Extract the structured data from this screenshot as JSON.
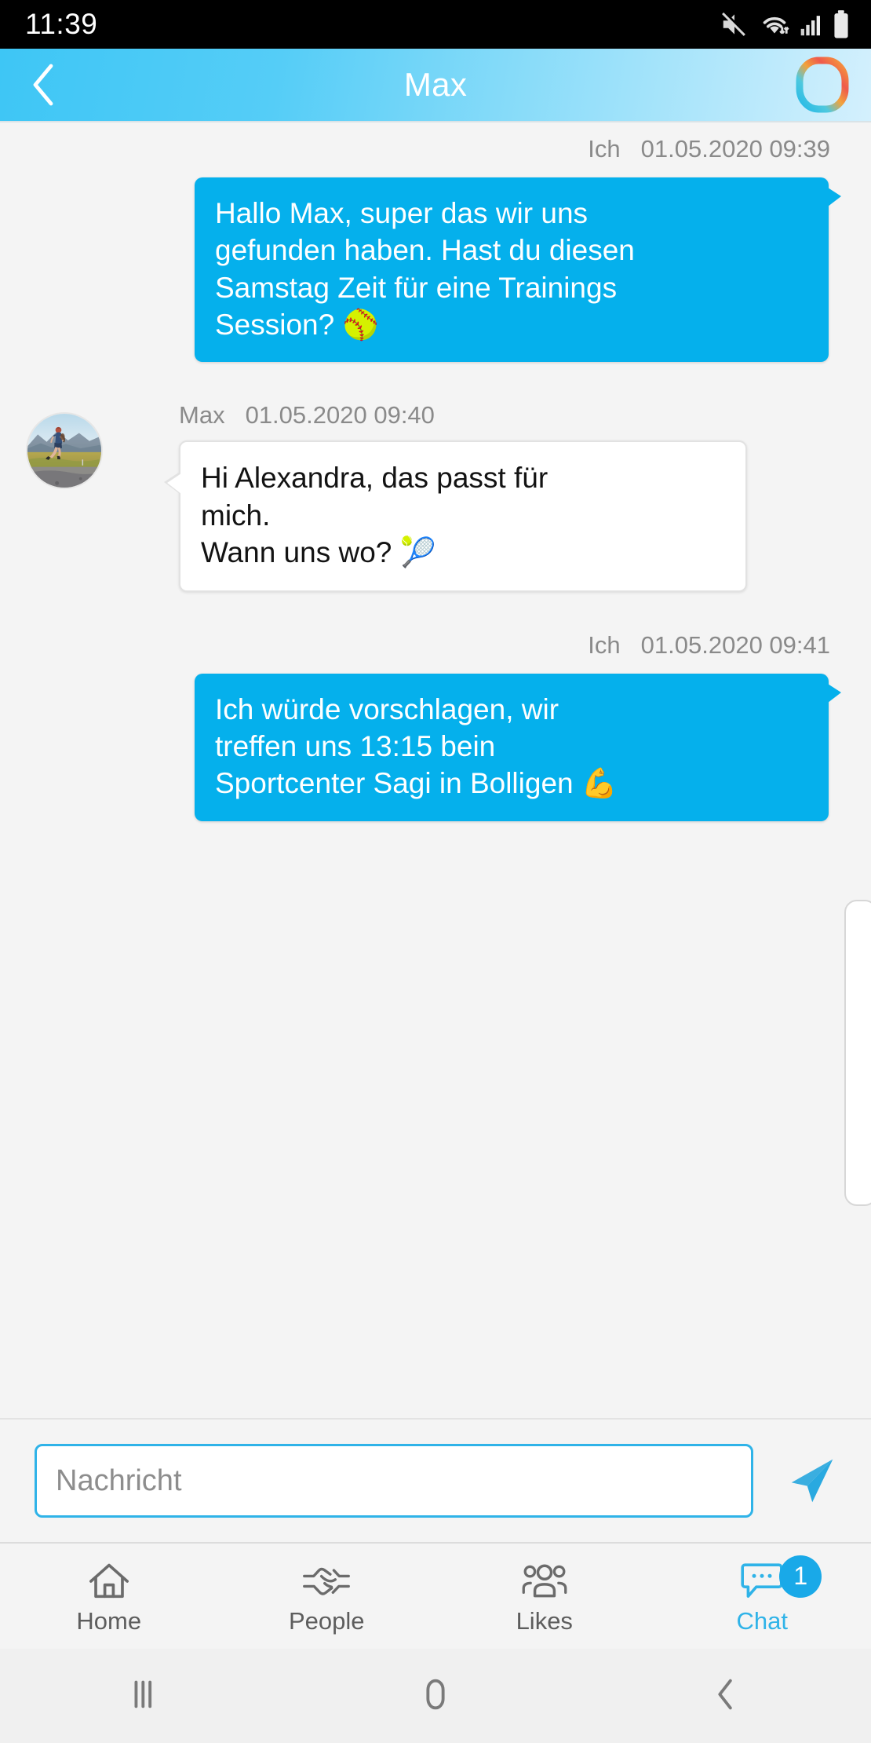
{
  "status_bar": {
    "time": "11:39",
    "icons": [
      "mute-icon",
      "wifi-icon",
      "signal-icon",
      "battery-icon"
    ]
  },
  "header": {
    "back_label": "back-chevron-icon",
    "title": "Max",
    "logo_name": "app-logo-icon",
    "gradient_from": "#3ec6f5",
    "gradient_to": "#d4f0fd"
  },
  "chat": {
    "outgoing_color": "#05b0ec",
    "incoming_color": "#ffffff",
    "messages": [
      {
        "direction": "out",
        "author": "Ich",
        "datetime": "01.05.2020 09:39",
        "lines": [
          "Hallo Max, super das wir uns",
          "gefunden haben. Hast du diesen",
          "Samstag Zeit für eine Trainings",
          "Session? 🥎"
        ],
        "emoji": "softball"
      },
      {
        "direction": "in",
        "author": "Max",
        "datetime": "01.05.2020 09:40",
        "avatar": "runner-photo-avatar",
        "lines": [
          "Hi Alexandra, das passt für",
          "mich.",
          "Wann uns wo? 🎾"
        ],
        "emoji": "tennis"
      },
      {
        "direction": "out",
        "author": "Ich",
        "datetime": "01.05.2020 09:41",
        "lines": [
          "Ich würde vorschlagen, wir",
          "treffen uns 13:15 bein",
          "Sportcenter Sagi in Bolligen 💪"
        ],
        "emoji": "biceps"
      }
    ]
  },
  "composer": {
    "placeholder": "Nachricht",
    "value": "",
    "send_label": "send-icon",
    "border_color": "#2fb3e8"
  },
  "tab_bar": {
    "accent": "#2fb3e8",
    "items": [
      {
        "label": "Home",
        "icon": "home-icon",
        "active": false,
        "badge": ""
      },
      {
        "label": "People",
        "icon": "handshake-icon",
        "active": false,
        "badge": ""
      },
      {
        "label": "Likes",
        "icon": "people-icon",
        "active": false,
        "badge": ""
      },
      {
        "label": "Chat",
        "icon": "chat-icon",
        "active": true,
        "badge": "1"
      }
    ]
  },
  "android_nav": {
    "recents_label": "recents-icon",
    "home_label": "home-button-icon",
    "back_label": "back-button-icon"
  }
}
